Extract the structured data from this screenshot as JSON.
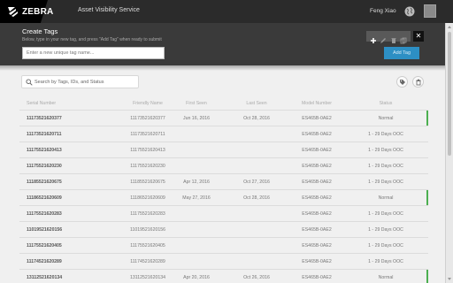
{
  "header": {
    "logo_text": "ZEBRA",
    "app_title": "Asset Visibility Service",
    "user_name": "Feng Xiao"
  },
  "create_tags": {
    "title": "Create Tags",
    "subtitle": "Below, type in your new tag, and press \"Add Tag\" when ready to submit",
    "input_placeholder": "Enter a new unique tag name...",
    "add_button": "Add Tag"
  },
  "search": {
    "placeholder": "Search by Tags, IDs, and Status"
  },
  "table": {
    "columns": [
      "Serial Number",
      "Friendly Name",
      "First Seen",
      "Last Seen",
      "Model Number",
      "Status"
    ],
    "rows": [
      {
        "serial": "11173521620377",
        "name": "11173521620377",
        "first": "Jun 16, 2016",
        "last": "Oct 28, 2016",
        "model": "ES465B-0AE2",
        "status": "Normal",
        "bar": true
      },
      {
        "serial": "11173521620711",
        "name": "11173521620711",
        "first": "",
        "last": "",
        "model": "ES465B-0AE2",
        "status": "1 - 29 Days OOC",
        "bar": false
      },
      {
        "serial": "11175521620413",
        "name": "11175521620413",
        "first": "",
        "last": "",
        "model": "ES465B-0AE2",
        "status": "1 - 29 Days OOC",
        "bar": false
      },
      {
        "serial": "11175521620230",
        "name": "11175521620230",
        "first": "",
        "last": "",
        "model": "ES465B-0AE2",
        "status": "1 - 29 Days OOC",
        "bar": false
      },
      {
        "serial": "11185521620675",
        "name": "11185521620675",
        "first": "Apr 12, 2016",
        "last": "Oct 27, 2016",
        "model": "ES465B-0AE2",
        "status": "1 - 29 Days OOC",
        "bar": false
      },
      {
        "serial": "11186521620609",
        "name": "11186521620609",
        "first": "May 27, 2016",
        "last": "Oct 28, 2016",
        "model": "ES465B-0AE2",
        "status": "Normal",
        "bar": true
      },
      {
        "serial": "11175521620283",
        "name": "11175521620283",
        "first": "",
        "last": "",
        "model": "ES465B-0AE2",
        "status": "1 - 29 Days OOC",
        "bar": false
      },
      {
        "serial": "11019521620156",
        "name": "11019521620156",
        "first": "",
        "last": "",
        "model": "ES465B-0AE2",
        "status": "1 - 29 Days OOC",
        "bar": false
      },
      {
        "serial": "11175521620405",
        "name": "11175521620405",
        "first": "",
        "last": "",
        "model": "ES465B-0AE2",
        "status": "1 - 29 Days OOC",
        "bar": false
      },
      {
        "serial": "11174521620289",
        "name": "11174521620289",
        "first": "",
        "last": "",
        "model": "ES465B-0AE2",
        "status": "1 - 29 Days OOC",
        "bar": false
      },
      {
        "serial": "13112521620134",
        "name": "13112521620134",
        "first": "Apr 20, 2016",
        "last": "Oct 26, 2016",
        "model": "ES465B-0AE2",
        "status": "Normal",
        "bar": true
      }
    ]
  },
  "colors": {
    "topbar": "#2b2b2b",
    "panel": "#3a3a3a",
    "accent": "#2d8fc4",
    "status_normal_bar": "#4caf50"
  },
  "icons": {
    "tools": [
      "plus-icon",
      "pencil-icon",
      "trash-icon",
      "copy-icon"
    ],
    "close": "close-icon",
    "globe": "globe-icon",
    "search": "search-icon",
    "tag_action": "tag-icon",
    "delete_action": "trash-icon"
  }
}
